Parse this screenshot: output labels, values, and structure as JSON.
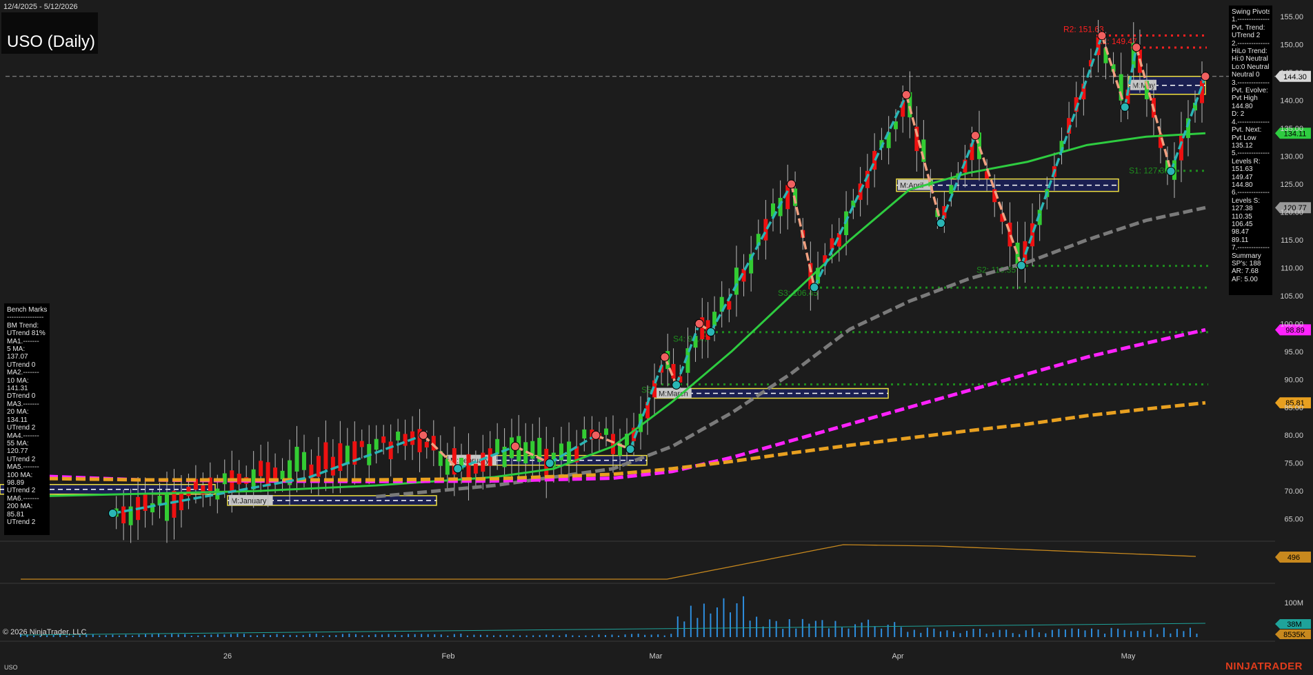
{
  "header": {
    "date_range": "12/4/2025 - 5/12/2026",
    "title": "USO (Daily)"
  },
  "footer": {
    "copyright": "© 2026 NinjaTrader, LLC",
    "symbol": "USO",
    "brand": "NINJATRADER"
  },
  "swing_pivots_panel": {
    "lines": [
      "Swing Pivots",
      "1.----------------",
      "Pvt. Trend:",
      "UTrend 2",
      "2.----------------",
      "HiLo Trend:",
      "Hi:0 Neutral",
      "Lo:0 Neutral",
      "Neutral 0",
      "3.----------------",
      "Pvt. Evolve:",
      "Pvt High",
      "144.80",
      "D: 2",
      "4.----------------",
      "Pvt. Next:",
      "Pvt Low",
      "135.12",
      "5.----------------",
      "Levels R:",
      "151.63",
      "149.47",
      "144.80",
      "6.----------------",
      "Levels S:",
      "127.38",
      "110.35",
      "106.45",
      "98.47",
      "89.11",
      "7.----------------",
      "Summary",
      "SP's: 188",
      "AR: 7.68",
      "AF: 5.00"
    ]
  },
  "bench_marks_panel": {
    "lines": [
      "Bench Marks",
      "----------------",
      "BM Trend:",
      "UTrend 81%",
      "MA1.-------",
      "5 MA:",
      "137.07",
      "UTrend 0",
      "MA2.-------",
      "10 MA:",
      "141.31",
      "DTrend 0",
      "MA3.-------",
      "20 MA:",
      "134.11",
      "UTrend 2",
      "MA4.-------",
      "55 MA:",
      "120.77",
      "UTrend 2",
      "MA5.-------",
      "100 MA:",
      "98.89",
      "UTrend 2",
      "MA6.-------",
      "200 MA:",
      "85.81",
      "UTrend 2"
    ]
  },
  "chart_data": [
    {
      "type": "line",
      "name": "price",
      "y_ticks": [
        155,
        150,
        145,
        140,
        135,
        130,
        125,
        120,
        115,
        110,
        105,
        100,
        95,
        90,
        85,
        80,
        75,
        70,
        65
      ],
      "ylim": [
        61,
        157
      ],
      "x_ticks": [
        "26",
        "Feb",
        "Mar",
        "Apr",
        "May"
      ],
      "price_tags": [
        {
          "label": "144.30",
          "value": 144.3,
          "color": "#d8d8d8",
          "text_color": "#000"
        },
        {
          "label": "134.11",
          "value": 134.11,
          "color": "#2ecc40",
          "text_color": "#000"
        },
        {
          "label": "120.77",
          "value": 120.77,
          "color": "#9a9a9a",
          "text_color": "#000"
        },
        {
          "label": "98.89",
          "value": 98.89,
          "color": "#ff22ff",
          "text_color": "#000"
        },
        {
          "label": "85.81",
          "value": 85.81,
          "color": "#e8a020",
          "text_color": "#000"
        }
      ],
      "level_labels": [
        {
          "text": "R2: 151.63",
          "value": 151.63,
          "color": "#ff2020"
        },
        {
          "text": "R1: 149.47",
          "value": 149.47,
          "color": "#ff2020"
        },
        {
          "text": "S1: 127.38",
          "value": 127.38,
          "color": "#1e8c1e"
        },
        {
          "text": "S2: 110.35",
          "value": 110.35,
          "color": "#1e8c1e"
        },
        {
          "text": "S3: 106.45",
          "value": 106.45,
          "color": "#1e8c1e"
        },
        {
          "text": "S4: 98.47",
          "value": 98.47,
          "color": "#1e8c1e"
        },
        {
          "text": "S5",
          "value": 89.11,
          "color": "#1e8c1e"
        }
      ],
      "monthly_boxes": [
        {
          "label": "M:January",
          "value": 68.3
        },
        {
          "label": "M:February",
          "value": 75.5
        },
        {
          "label": "M:March",
          "value": 87.5
        },
        {
          "label": "M:April",
          "value": 124.8
        },
        {
          "label": "M:May",
          "value": 142.7
        },
        {
          "label": "",
          "value": 70.3
        }
      ],
      "series": [
        {
          "name": "20 MA",
          "color": "#2ecc40",
          "points": [
            [
              0,
              69
            ],
            [
              0.1,
              69.5
            ],
            [
              0.2,
              70
            ],
            [
              0.3,
              71
            ],
            [
              0.4,
              72.5
            ],
            [
              0.45,
              74
            ],
            [
              0.5,
              78
            ],
            [
              0.55,
              86
            ],
            [
              0.6,
              95
            ],
            [
              0.65,
              105
            ],
            [
              0.7,
              115
            ],
            [
              0.75,
              124
            ],
            [
              0.8,
              127
            ],
            [
              0.85,
              129
            ],
            [
              0.9,
              132
            ],
            [
              0.95,
              133.5
            ],
            [
              1.0,
              134.11
            ]
          ]
        },
        {
          "name": "55 MA",
          "color": "#7a7a7a",
          "points": [
            [
              0.3,
              69
            ],
            [
              0.4,
              71
            ],
            [
              0.5,
              74
            ],
            [
              0.55,
              78
            ],
            [
              0.6,
              84
            ],
            [
              0.65,
              91
            ],
            [
              0.7,
              99
            ],
            [
              0.75,
              104
            ],
            [
              0.8,
              108
            ],
            [
              0.85,
              111
            ],
            [
              0.9,
              115
            ],
            [
              0.95,
              118.5
            ],
            [
              1.0,
              120.77
            ]
          ]
        },
        {
          "name": "100 MA",
          "color": "#ff22ff",
          "points": [
            [
              0,
              72.8
            ],
            [
              0.1,
              72
            ],
            [
              0.2,
              71.8
            ],
            [
              0.3,
              71.7
            ],
            [
              0.4,
              71.8
            ],
            [
              0.5,
              72.3
            ],
            [
              0.55,
              73.5
            ],
            [
              0.6,
              76
            ],
            [
              0.65,
              79
            ],
            [
              0.7,
              82
            ],
            [
              0.75,
              85
            ],
            [
              0.8,
              88
            ],
            [
              0.85,
              91
            ],
            [
              0.9,
              94
            ],
            [
              0.95,
              96.5
            ],
            [
              1.0,
              98.89
            ]
          ]
        },
        {
          "name": "200 MA",
          "color": "#e8a020",
          "points": [
            [
              0,
              72.3
            ],
            [
              0.1,
              72
            ],
            [
              0.2,
              72
            ],
            [
              0.3,
              72
            ],
            [
              0.4,
              72.2
            ],
            [
              0.5,
              73
            ],
            [
              0.55,
              74
            ],
            [
              0.6,
              75.3
            ],
            [
              0.65,
              76.8
            ],
            [
              0.7,
              78.2
            ],
            [
              0.75,
              79.5
            ],
            [
              0.8,
              80.8
            ],
            [
              0.85,
              82
            ],
            [
              0.9,
              83.5
            ],
            [
              0.95,
              84.7
            ],
            [
              1.0,
              85.81
            ]
          ]
        }
      ],
      "swing_legs": [
        {
          "color": "up",
          "points": [
            [
              0.08,
              66
            ],
            [
              0.25,
              72.4
            ],
            [
              0.35,
              80
            ]
          ]
        },
        {
          "color": "down",
          "points": [
            [
              0.35,
              80
            ],
            [
              0.38,
              74
            ]
          ]
        },
        {
          "color": "up",
          "points": [
            [
              0.38,
              74
            ],
            [
              0.43,
              78
            ]
          ]
        },
        {
          "color": "down",
          "points": [
            [
              0.43,
              78
            ],
            [
              0.46,
              75
            ]
          ]
        },
        {
          "color": "up",
          "points": [
            [
              0.46,
              75
            ],
            [
              0.5,
              80
            ]
          ]
        },
        {
          "color": "down",
          "points": [
            [
              0.5,
              80
            ],
            [
              0.53,
              77.5
            ]
          ]
        },
        {
          "color": "up",
          "points": [
            [
              0.53,
              77.5
            ],
            [
              0.56,
              94
            ]
          ]
        },
        {
          "color": "down",
          "points": [
            [
              0.56,
              94
            ],
            [
              0.57,
              89
            ]
          ]
        },
        {
          "color": "up",
          "points": [
            [
              0.57,
              89
            ],
            [
              0.59,
              100
            ]
          ]
        },
        {
          "color": "down",
          "points": [
            [
              0.59,
              100
            ],
            [
              0.6,
              98.5
            ]
          ]
        },
        {
          "color": "up",
          "points": [
            [
              0.6,
              98.5
            ],
            [
              0.67,
              125
            ]
          ]
        },
        {
          "color": "down",
          "points": [
            [
              0.67,
              125
            ],
            [
              0.69,
              106.5
            ]
          ]
        },
        {
          "color": "up",
          "points": [
            [
              0.69,
              106.5
            ],
            [
              0.77,
              141
            ]
          ]
        },
        {
          "color": "down",
          "points": [
            [
              0.77,
              141
            ],
            [
              0.8,
              118
            ]
          ]
        },
        {
          "color": "up",
          "points": [
            [
              0.8,
              118
            ],
            [
              0.83,
              133.7
            ]
          ]
        },
        {
          "color": "down",
          "points": [
            [
              0.83,
              133.7
            ],
            [
              0.87,
              110.4
            ]
          ]
        },
        {
          "color": "up",
          "points": [
            [
              0.87,
              110.4
            ],
            [
              0.94,
              151.6
            ]
          ]
        },
        {
          "color": "down",
          "points": [
            [
              0.94,
              151.6
            ],
            [
              0.96,
              138.8
            ]
          ]
        },
        {
          "color": "up",
          "points": [
            [
              0.96,
              138.8
            ],
            [
              0.97,
              149.5
            ]
          ]
        },
        {
          "color": "down",
          "points": [
            [
              0.97,
              149.5
            ],
            [
              1.0,
              127.3
            ]
          ]
        },
        {
          "color": "up",
          "points": [
            [
              1.0,
              127.3
            ],
            [
              1.03,
              144.3
            ]
          ]
        }
      ]
    },
    {
      "type": "line",
      "name": "oscillator",
      "last_value": 496,
      "label": "496",
      "color": "#c8891e"
    },
    {
      "type": "bar",
      "name": "volume",
      "y_ticks": [
        "100M"
      ],
      "tags": [
        {
          "label": "38M",
          "color": "#1fa39a"
        },
        {
          "label": "8535K",
          "color": "#c8891e"
        }
      ]
    }
  ]
}
